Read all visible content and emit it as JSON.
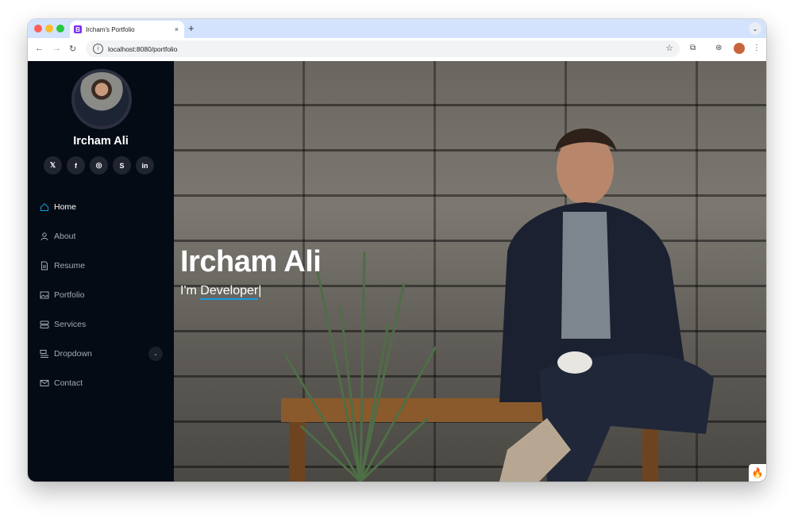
{
  "browser": {
    "tab_title": "Ircham's Portfolio",
    "tab_favicon_letter": "B",
    "tab_close": "×",
    "new_tab": "+",
    "url": "localhost:8080/portfolio"
  },
  "sidebar": {
    "name": "Ircham Ali",
    "socials": [
      {
        "icon": "x-twitter-icon",
        "glyph": "𝕏"
      },
      {
        "icon": "facebook-icon",
        "glyph": "f"
      },
      {
        "icon": "instagram-icon",
        "glyph": "◎"
      },
      {
        "icon": "skype-icon",
        "glyph": "S"
      },
      {
        "icon": "linkedin-icon",
        "glyph": "in"
      }
    ],
    "menu": [
      {
        "label": "Home",
        "icon": "house-icon",
        "active": true
      },
      {
        "label": "About",
        "icon": "person-icon",
        "active": false
      },
      {
        "label": "Resume",
        "icon": "file-icon",
        "active": false
      },
      {
        "label": "Portfolio",
        "icon": "images-icon",
        "active": false
      },
      {
        "label": "Services",
        "icon": "hdd-stack-icon",
        "active": false
      },
      {
        "label": "Dropdown",
        "icon": "menu-list-icon",
        "active": false,
        "has_chevron": true
      },
      {
        "label": "Contact",
        "icon": "envelope-icon",
        "active": false
      }
    ]
  },
  "hero": {
    "title": "Ircham Ali",
    "subtitle_prefix": "I'm ",
    "subtitle_typed": "Developer",
    "cursor": "|"
  },
  "colors": {
    "sidebar_bg": "#040b14",
    "accent": "#149ddd",
    "browser_tabstrip": "#d3e3fd"
  }
}
